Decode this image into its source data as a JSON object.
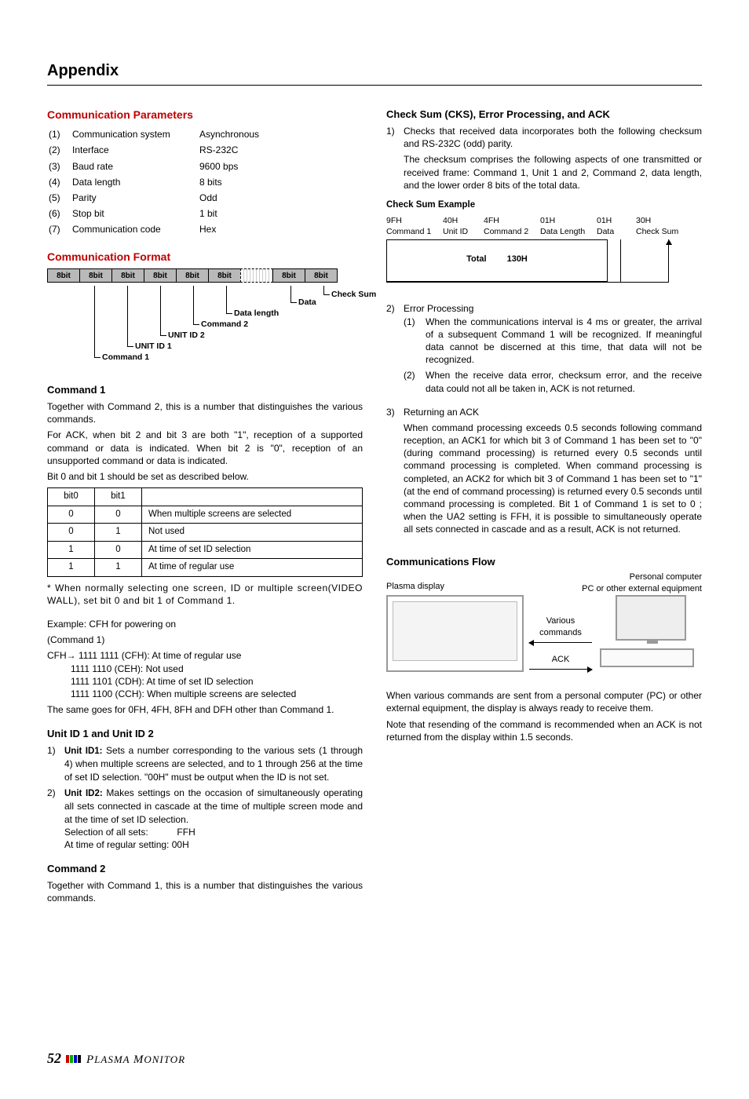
{
  "page": {
    "title": "Appendix"
  },
  "left": {
    "commParamsTitle": "Communication Parameters",
    "params": [
      {
        "n": "(1)",
        "k": "Communication system",
        "v": "Asynchronous"
      },
      {
        "n": "(2)",
        "k": "Interface",
        "v": "RS-232C"
      },
      {
        "n": "(3)",
        "k": "Baud rate",
        "v": "9600 bps"
      },
      {
        "n": "(4)",
        "k": "Data length",
        "v": "8 bits"
      },
      {
        "n": "(5)",
        "k": "Parity",
        "v": "Odd"
      },
      {
        "n": "(6)",
        "k": "Stop bit",
        "v": "1 bit"
      },
      {
        "n": "(7)",
        "k": "Communication code",
        "v": "Hex"
      }
    ],
    "commFormatTitle": "Communication Format",
    "fmtCell": "8bit",
    "fmtLabels": {
      "checksum": "Check Sum",
      "data": "Data",
      "datalen": "Data length",
      "cmd2": "Command 2",
      "uid2": "UNIT ID 2",
      "uid1": "UNIT ID 1",
      "cmd1": "Command 1"
    },
    "cmd1Title": "Command 1",
    "cmd1p1": "Together with Command 2, this is a number that distinguishes the various commands.",
    "cmd1p2": "For ACK, when bit 2 and bit 3 are both \"1\", reception of a supported command or data is indicated. When bit 2 is \"0\", reception of an unsupported command or data is indicated.",
    "cmd1p3": "Bit 0 and bit 1 should be set as described below.",
    "bitTable": {
      "h0": "bit0",
      "h1": "bit1",
      "rows": [
        {
          "b0": "0",
          "b1": "0",
          "d": "When multiple screens are selected"
        },
        {
          "b0": "0",
          "b1": "1",
          "d": "Not used"
        },
        {
          "b0": "1",
          "b1": "0",
          "d": "At time of set ID selection"
        },
        {
          "b0": "1",
          "b1": "1",
          "d": "At time of regular use"
        }
      ]
    },
    "note": "* When normally selecting one screen, ID or multiple screen(VIDEO WALL), set bit 0 and bit 1 of Command 1.",
    "exTitle": "Example: CFH for powering on",
    "exSub": "(Command 1)",
    "exLines": [
      "CFH→ 1111 1111 (CFH): At time of regular use",
      "1111 1110 (CEH): Not used",
      "1111 1101 (CDH): At time of set ID selection",
      "1111 1100 (CCH): When multiple screens are selected"
    ],
    "exTail": "The same goes for 0FH, 4FH, 8FH and DFH other than Command 1.",
    "uidTitle": "Unit ID 1 and Unit ID 2",
    "uid1": {
      "lead": "1)",
      "bold": "Unit ID1:",
      "body": " Sets a number corresponding to the various sets (1 through 4) when multiple screens are selected, and to 1 through 256 at the time of set ID selection. \"00H\" must be output when the ID is not set."
    },
    "uid2": {
      "lead": "2)",
      "bold": "Unit ID2:",
      "body": " Makes settings on the occasion of simultaneously operating all sets connected in cascade at the time of multiple screen mode and at the time of set ID selection."
    },
    "uid2a": "Selection of all sets:",
    "uid2av": "FFH",
    "uid2b": "At time of regular setting:  00H",
    "cmd2Title": "Command 2",
    "cmd2p": "Together with Command 1, this is a number that distinguishes the various commands."
  },
  "right": {
    "cksTitle": "Check Sum (CKS), Error Processing, and ACK",
    "cks1": {
      "lead": "1)",
      "body": "Checks that received data incorporates both the following checksum and RS-232C (odd) parity."
    },
    "cks1b": "The checksum comprises the following aspects of one transmitted or received frame: Command 1, Unit 1 and 2, Command 2, data length, and the lower order 8 bits of the total data.",
    "cksExTitle": "Check Sum Example",
    "cksHeaders": [
      {
        "v": "9FH",
        "l": "Command 1"
      },
      {
        "v": "40H",
        "l": "Unit ID"
      },
      {
        "v": "4FH",
        "l": "Command 2"
      },
      {
        "v": "01H",
        "l": "Data Length"
      },
      {
        "v": "01H",
        "l": "Data"
      },
      {
        "v": "30H",
        "l": "Check Sum"
      }
    ],
    "cksTotal": "Total",
    "cksTotalVal": "130H",
    "err": {
      "lead": "2)",
      "title": "Error Processing"
    },
    "err1": {
      "lead": "(1)",
      "body": "When the communications interval is 4 ms or greater, the arrival of a subsequent Command 1 will be recognized. If meaningful data cannot be discerned at this time, that data will not be recognized."
    },
    "err2": {
      "lead": "(2)",
      "body": "When the receive data error, checksum error, and the receive data could not all be taken in, ACK is not returned."
    },
    "ack": {
      "lead": "3)",
      "title": "Returning an ACK"
    },
    "ackBody": "When command processing exceeds 0.5 seconds following command reception, an ACK1 for which bit 3 of Command 1 has been set to \"0\" (during command processing) is returned every 0.5 seconds until command processing is completed. When command processing is completed, an ACK2 for which bit 3 of Command 1 has been set to \"1\" (at the end of command processing) is returned every 0.5 seconds until command processing is completed. Bit 1 of Command 1 is set to 0 ; when the UA2 setting is FFH, it is possible to simultaneously operate all sets connected in cascade and as a result, ACK is not returned.",
    "flowTitle": "Communications Flow",
    "flowL": "Plasma display",
    "flowR1": "Personal computer",
    "flowR2": "PC or other external equipment",
    "flowCmd": "Various commands",
    "flowAck": "ACK",
    "flowP1": "When various commands are sent from a personal computer (PC) or other external equipment, the display is always ready to receive them.",
    "flowP2": "Note that resending of the command is recommended when an ACK is not returned from the display within 1.5 seconds."
  },
  "footer": {
    "page": "52",
    "text": "PLASMA MONITOR"
  },
  "chart_data": {
    "type": "table",
    "title": "Check Sum Example",
    "columns": [
      "Command 1",
      "Unit ID",
      "Command 2",
      "Data Length",
      "Data",
      "Check Sum"
    ],
    "values_hex": [
      "9FH",
      "40H",
      "4FH",
      "01H",
      "01H",
      "30H"
    ],
    "total_label": "Total",
    "total_value": "130H"
  }
}
